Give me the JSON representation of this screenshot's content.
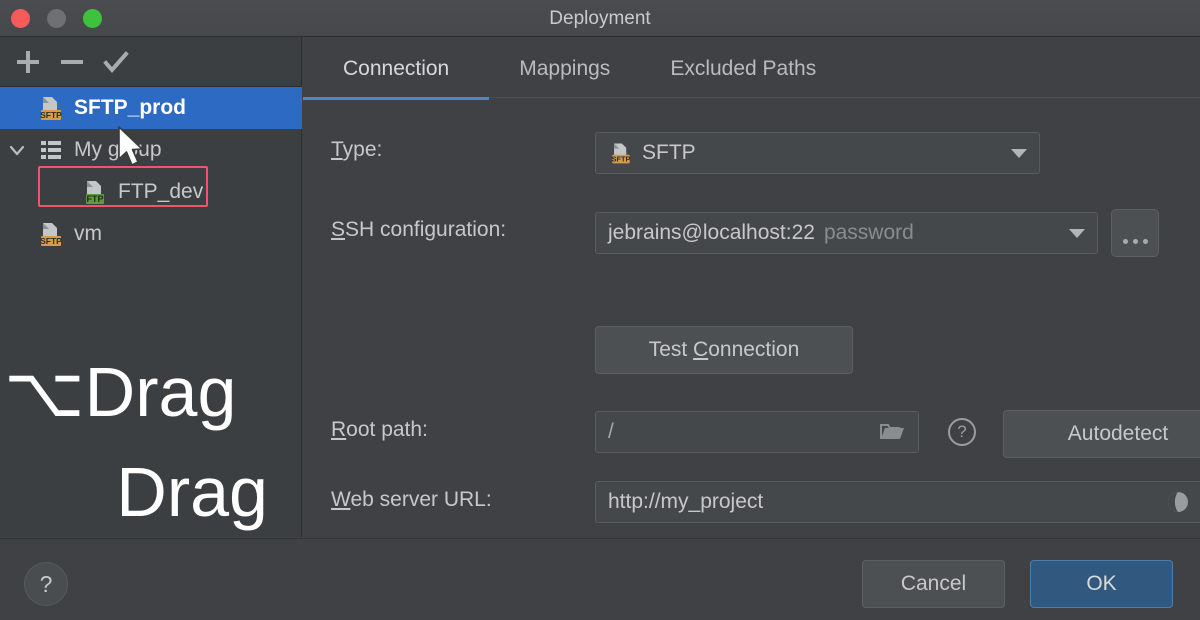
{
  "window": {
    "title": "Deployment",
    "traffic_lights": [
      "close",
      "minimize",
      "zoom"
    ]
  },
  "sidebar": {
    "toolbar": [
      {
        "name": "add",
        "icon": "plus-icon",
        "label": "+"
      },
      {
        "name": "remove",
        "icon": "minus-icon",
        "label": "−"
      },
      {
        "name": "set-default",
        "icon": "check-icon",
        "label": "✓"
      }
    ],
    "tree": [
      {
        "label": "SFTP_prod",
        "icon": "sftp-icon",
        "badge": "SFTP",
        "badge_color": "#d89b4a",
        "selected": true,
        "depth": 1,
        "expandable": false
      },
      {
        "label": "My group",
        "icon": "group-icon",
        "badge": "",
        "badge_color": "",
        "selected": false,
        "depth": 0,
        "expandable": true,
        "expanded": true,
        "highlighted": true
      },
      {
        "label": "FTP_dev",
        "icon": "ftp-icon",
        "badge": "FTP",
        "badge_color": "#5d9c3c",
        "selected": false,
        "depth": 2,
        "expandable": false
      },
      {
        "label": "vm",
        "icon": "sftp-icon",
        "badge": "SFTP",
        "badge_color": "#d89b4a",
        "selected": false,
        "depth": 1,
        "expandable": false
      }
    ],
    "drag_hint_line1": "⌥Drag",
    "drag_hint_line2": "Drag"
  },
  "tabs": [
    {
      "label": "Connection",
      "active": true
    },
    {
      "label": "Mappings",
      "active": false
    },
    {
      "label": "Excluded Paths",
      "active": false
    }
  ],
  "form": {
    "type": {
      "label_prefix": "",
      "label_mnemonic": "T",
      "label_suffix": "ype:",
      "value": "SFTP",
      "badge": "SFTP",
      "badge_color": "#d89b4a"
    },
    "ssh_configuration": {
      "label_prefix": "",
      "label_mnemonic": "S",
      "label_suffix": "SH configuration:",
      "value": "jebrains@localhost:22",
      "auth": "password",
      "more_button": "..."
    },
    "test_connection": {
      "label_prefix": "Test ",
      "label_mnemonic": "C",
      "label_suffix": "onnection"
    },
    "root_path": {
      "label_prefix": "",
      "label_mnemonic": "R",
      "label_suffix": "oot path:",
      "value": "/",
      "browse_icon": "folder-icon",
      "help_icon": "question-icon",
      "autodetect_label": "Autodetect"
    },
    "web_server_url": {
      "label_prefix": "",
      "label_mnemonic": "W",
      "label_suffix": "eb server URL:",
      "value": "http://my_project",
      "globe_icon": "globe-icon"
    }
  },
  "footer": {
    "help": "?",
    "cancel": "Cancel",
    "ok": "OK"
  },
  "colors": {
    "accent_selection": "#2d6ac4",
    "accent_tab": "#4a88c7",
    "highlight_ring": "#f4546a",
    "ok_button": "#31587f",
    "sftp_badge": "#d89b4a",
    "ftp_badge": "#5d9c3c"
  }
}
